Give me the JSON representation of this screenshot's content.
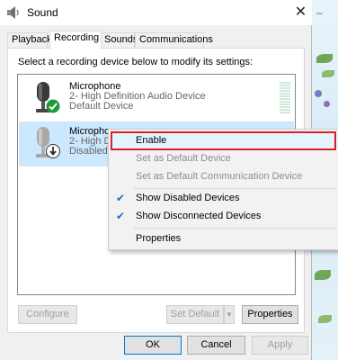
{
  "window": {
    "title": "Sound"
  },
  "tabs": [
    {
      "label": "Playback",
      "active": false
    },
    {
      "label": "Recording",
      "active": true
    },
    {
      "label": "Sounds",
      "active": false
    },
    {
      "label": "Communications",
      "active": false
    }
  ],
  "instruction": "Select a recording device below to modify its settings:",
  "devices": [
    {
      "name": "Microphone",
      "detail": "2- High Definition Audio Device",
      "status": "Default Device",
      "status_icon": "check-icon",
      "status_color": "#1f9a3a"
    },
    {
      "name": "Microphone",
      "detail": "2- High D",
      "status": "Disabled",
      "status_icon": "down-arrow-icon",
      "status_color": "#303030"
    }
  ],
  "buttons": {
    "configure": "Configure",
    "set_default": "Set Default",
    "properties": "Properties",
    "ok": "OK",
    "cancel": "Cancel",
    "apply": "Apply"
  },
  "context_menu": {
    "items": [
      {
        "label": "Enable",
        "enabled": true,
        "highlighted": true
      },
      {
        "label": "Set as Default Device",
        "enabled": false
      },
      {
        "label": "Set as Default Communication Device",
        "enabled": false
      },
      {
        "label": "Show Disabled Devices",
        "enabled": true,
        "checked": true
      },
      {
        "label": "Show Disconnected Devices",
        "enabled": true,
        "checked": true
      },
      {
        "label": "Properties",
        "enabled": true
      }
    ]
  },
  "colors": {
    "selection": "#cce8ff",
    "highlight_border": "#d9202a",
    "focus_border": "#0078d7"
  }
}
